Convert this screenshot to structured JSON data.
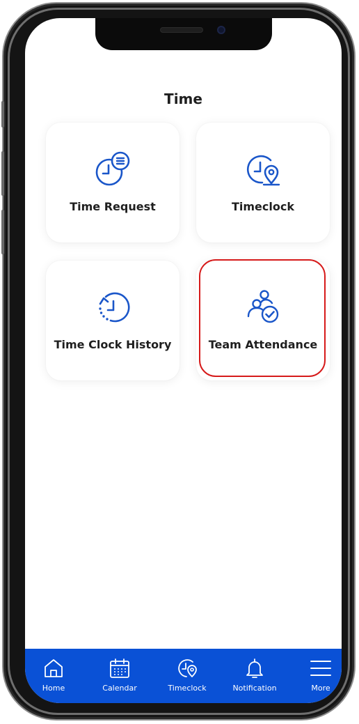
{
  "page": {
    "title": "Time"
  },
  "tiles": [
    {
      "label": "Time Request",
      "icon": "clock-list-icon"
    },
    {
      "label": "Timeclock",
      "icon": "clock-location-icon"
    },
    {
      "label": "Time Clock History",
      "icon": "clock-history-icon"
    },
    {
      "label": "Team Attendance",
      "icon": "team-check-icon",
      "highlighted": true
    }
  ],
  "tabbar": {
    "items": [
      {
        "label": "Home",
        "icon": "home-icon"
      },
      {
        "label": "Calendar",
        "icon": "calendar-icon"
      },
      {
        "label": "Timeclock",
        "icon": "clock-location-icon"
      },
      {
        "label": "Notification",
        "icon": "bell-icon"
      },
      {
        "label": "More",
        "icon": "menu-icon"
      }
    ]
  },
  "colors": {
    "accent": "#1A56C9",
    "tabbar": "#0A51D6",
    "highlight": "#D61A1A",
    "text": "#1F1F1F"
  }
}
